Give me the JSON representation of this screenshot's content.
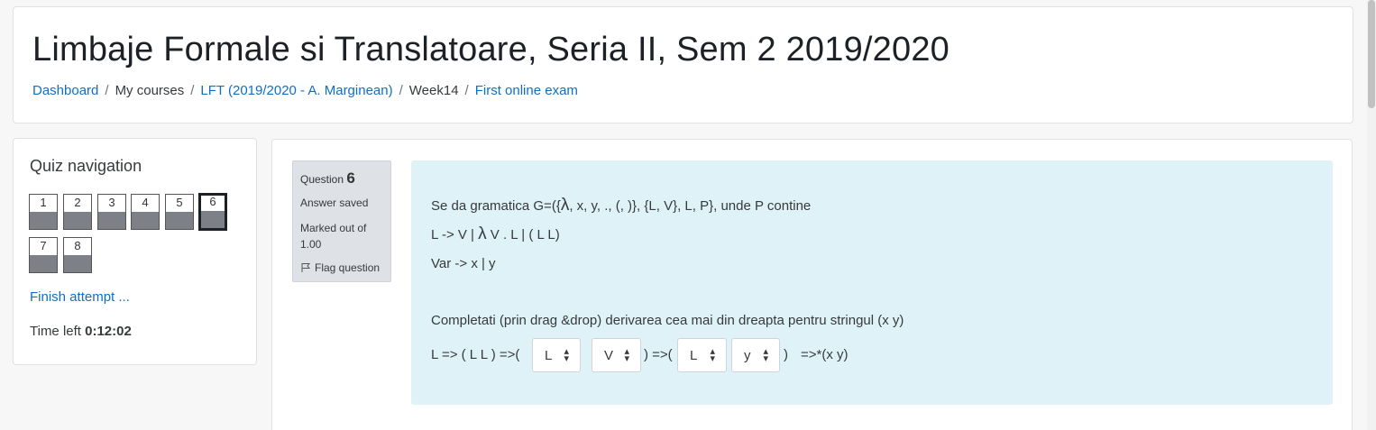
{
  "header": {
    "title": "Limbaje Formale si Translatoare, Seria II, Sem 2 2019/2020",
    "breadcrumb": [
      {
        "label": "Dashboard",
        "link": true
      },
      {
        "label": "My courses",
        "link": false
      },
      {
        "label": "LFT (2019/2020 - A. Marginean)",
        "link": true
      },
      {
        "label": "Week14",
        "link": false
      },
      {
        "label": "First online exam",
        "link": true
      }
    ],
    "separator": "/"
  },
  "quiz_nav": {
    "title": "Quiz navigation",
    "buttons": [
      {
        "label": "1",
        "current": false
      },
      {
        "label": "2",
        "current": false
      },
      {
        "label": "3",
        "current": false
      },
      {
        "label": "4",
        "current": false
      },
      {
        "label": "5",
        "current": false
      },
      {
        "label": "6",
        "current": true
      },
      {
        "label": "7",
        "current": false
      },
      {
        "label": "8",
        "current": false
      }
    ],
    "finish_label": "Finish attempt ...",
    "time_label": "Time left",
    "time_value": "0:12:02"
  },
  "question_info": {
    "question_word": "Question",
    "number": "6",
    "state": "Answer saved",
    "grade": "Marked out of 1.00",
    "flag_label": "Flag question"
  },
  "question": {
    "line1_pre": "Se da gramatica G=({",
    "line1_lambda": "λ",
    "line1_post": ", x, y, ., (, )}, {L, V}, L, P}, unde P contine",
    "line2_pre": "L -> V | ",
    "line2_lambda": "λ",
    "line2_post": " V . L | ( L L)",
    "line3": "Var -> x | y",
    "prompt": "Completati (prin drag &drop) derivarea cea mai din dreapta pentru stringul (x  y)",
    "deriv_t1": "L => ( L L ) =>(",
    "deriv_t2": ") =>(",
    "deriv_t3": ")",
    "deriv_t4": "=>*(x y)",
    "selects": [
      "L",
      "V",
      "L",
      "y"
    ]
  },
  "colors": {
    "link": "#0f6fc5",
    "question_bg": "#def2f8",
    "info_bg": "#dee2e6",
    "nav_fill": "#7d8086"
  }
}
